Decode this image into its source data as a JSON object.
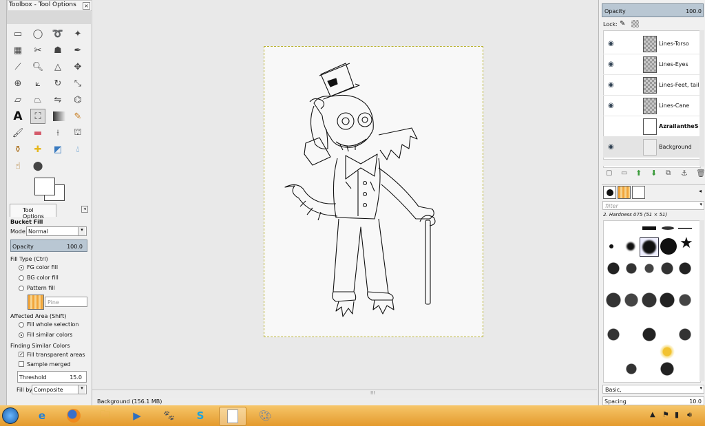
{
  "toolbox": {
    "title": "Toolbox - Tool Options",
    "tool_options_tab": "Tool Options",
    "tool_name": "Bucket Fill",
    "mode_label": "Mode:",
    "mode_value": "Normal",
    "opacity_label": "Opacity",
    "opacity_value": "100.0",
    "fill_type_label": "Fill Type  (Ctrl)",
    "fill_options": [
      "FG color fill",
      "BG color fill",
      "Pattern fill"
    ],
    "pattern_name": "Pine",
    "affected_area_label": "Affected Area  (Shift)",
    "affected_options": [
      "Fill whole selection",
      "Fill similar colors"
    ],
    "finding_label": "Finding Similar Colors",
    "fill_transparent": "Fill transparent areas",
    "sample_merged": "Sample merged",
    "threshold_label": "Threshold",
    "threshold_value": "15.0",
    "fill_by_label": "Fill by:",
    "fill_by_value": "Composite"
  },
  "status": {
    "text": "Background (156.1 MB)"
  },
  "layers": {
    "opacity_label": "Opacity",
    "opacity_value": "100.0",
    "lock_label": "Lock:",
    "items": [
      {
        "name": "Lines-Torso",
        "visible": true
      },
      {
        "name": "Lines-Eyes",
        "visible": true
      },
      {
        "name": "Lines-Feet, tail, w",
        "visible": true
      },
      {
        "name": "Lines-Cane",
        "visible": true
      },
      {
        "name": "AzrailantheScor",
        "visible": false
      },
      {
        "name": "Background",
        "visible": true
      }
    ]
  },
  "brushes": {
    "filter_placeholder": "filter",
    "current": "2. Hardness 075 (51 × 51)",
    "preset": "Basic,",
    "spacing_label": "Spacing",
    "spacing_value": "10.0"
  },
  "taskbar": {
    "apps": [
      "start",
      "internet-explorer",
      "firefox",
      "file-explorer",
      "media-player",
      "gimp",
      "skype",
      "image-viewer",
      "paint"
    ]
  }
}
